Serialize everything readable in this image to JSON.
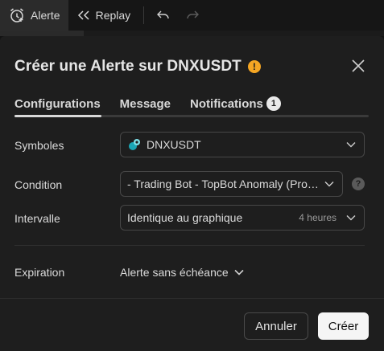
{
  "toolbar": {
    "alert_label": "Alerte",
    "replay_label": "Replay"
  },
  "dialog": {
    "title": "Créer une Alerte sur DNXUSDT",
    "warning_icon_text": "!",
    "tabs": [
      {
        "label": "Configurations"
      },
      {
        "label": "Message"
      },
      {
        "label": "Notifications",
        "badge": "1"
      }
    ],
    "symbols": {
      "label": "Symboles",
      "value": "DNXUSDT"
    },
    "condition": {
      "label": "Condition",
      "value": "- Trading Bot - TopBot Anomaly (Prof…",
      "help_text": "?"
    },
    "interval": {
      "label": "Intervalle",
      "value": "Identique au graphique",
      "hint": "4 heures"
    },
    "expiration": {
      "label": "Expiration",
      "value": "Alerte sans échéance"
    },
    "buttons": {
      "cancel": "Annuler",
      "create": "Créer"
    }
  },
  "colors": {
    "background": "#1e1e1e",
    "warning": "#f5a623",
    "primary_button": "#f5f5f5"
  }
}
